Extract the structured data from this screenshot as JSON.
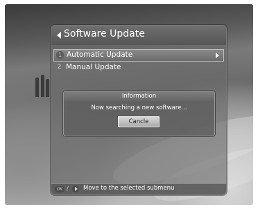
{
  "menu": {
    "title": "Software Update",
    "items": [
      {
        "number": "1",
        "label": "Automatic Update",
        "selected": true
      },
      {
        "number": "2",
        "label": "Manual Update",
        "selected": false
      }
    ]
  },
  "dialog": {
    "title": "Information",
    "message": "Now searching a new software...",
    "cancel_label": "Cancle"
  },
  "help": {
    "ok_key": "OK",
    "separator": "/",
    "text": "Move to the selected submenu"
  }
}
